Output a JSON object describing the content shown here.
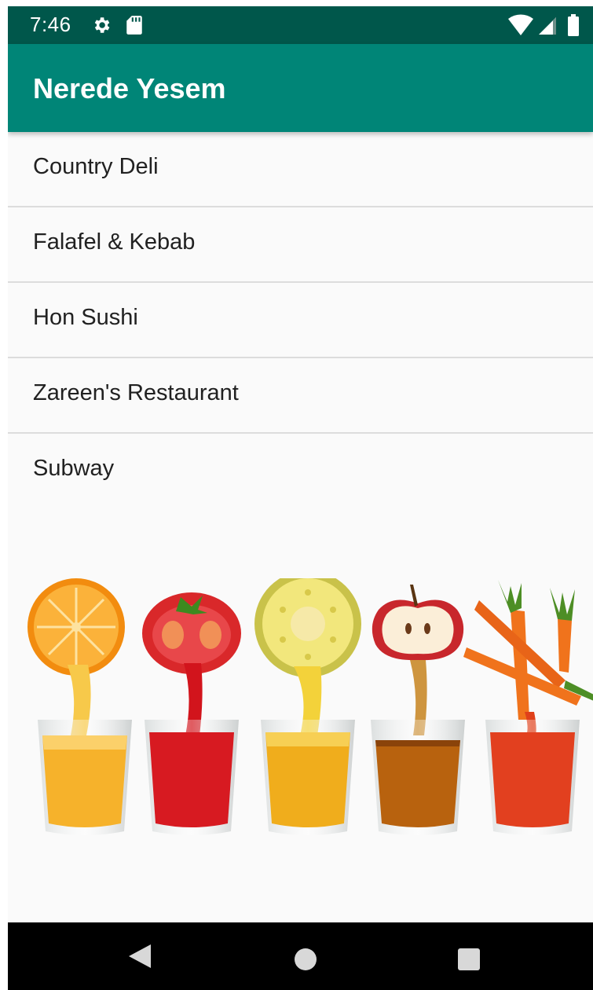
{
  "status_bar": {
    "time": "7:46"
  },
  "app_bar": {
    "title": "Nerede Yesem"
  },
  "restaurants": [
    {
      "name": "Country Deli"
    },
    {
      "name": "Falafel & Kebab"
    },
    {
      "name": "Hon Sushi"
    },
    {
      "name": "Zareen's Restaurant"
    },
    {
      "name": "Subway"
    }
  ],
  "colors": {
    "status_bar": "#00574b",
    "app_bar": "#008577",
    "background": "#fafafa",
    "nav_bar": "#000000"
  },
  "image": {
    "depicts": [
      "orange-juice-icon",
      "tomato-juice-icon",
      "pineapple-juice-icon",
      "apple-juice-icon",
      "carrot-juice-icon"
    ]
  }
}
